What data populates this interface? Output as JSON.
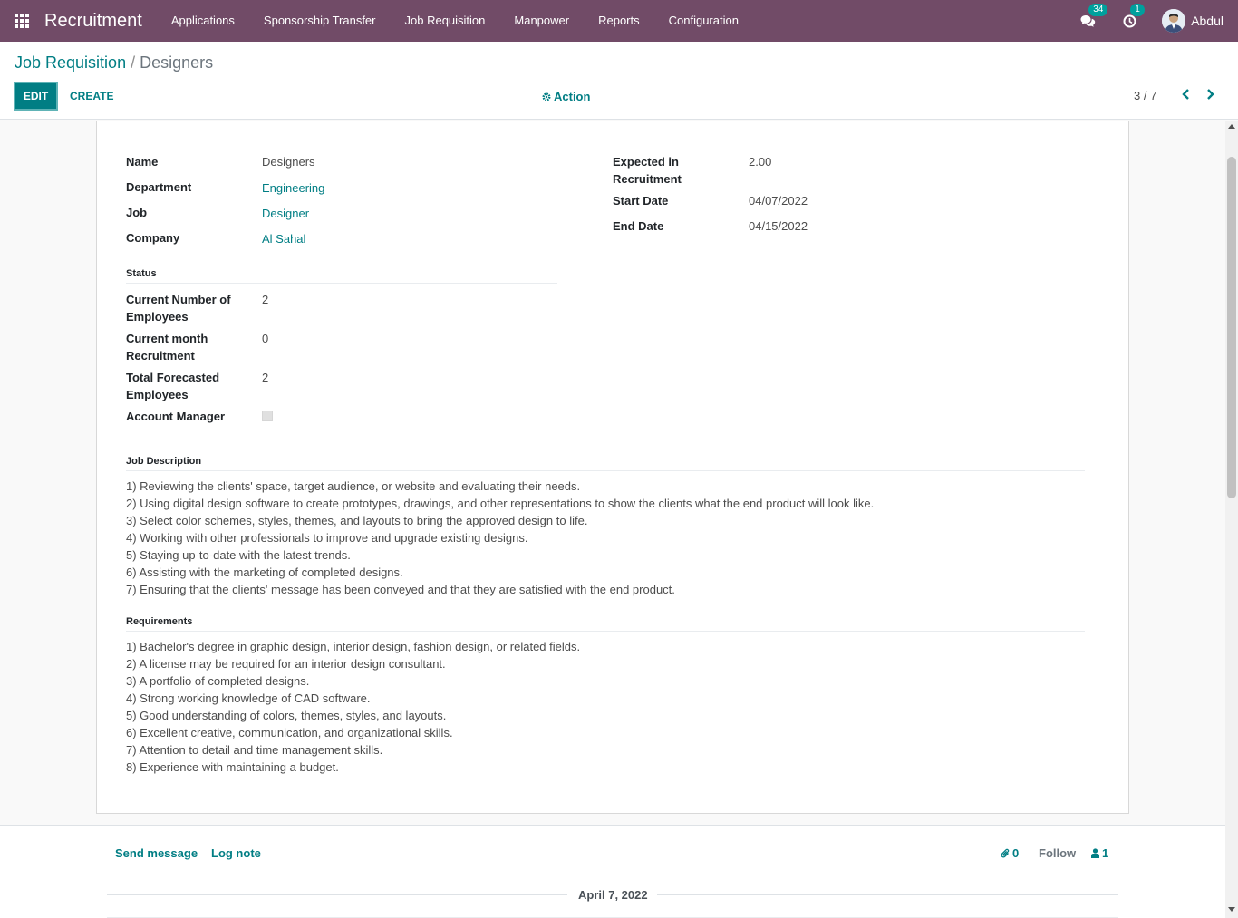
{
  "navbar": {
    "app_name": "Recruitment",
    "menu": [
      "Applications",
      "Sponsorship Transfer",
      "Job Requisition",
      "Manpower",
      "Reports",
      "Configuration"
    ],
    "messages_count": "34",
    "activities_count": "1",
    "user_name": "Abdul",
    "colors": {
      "bar": "#714b67",
      "badge": "#00a09d"
    }
  },
  "control_panel": {
    "breadcrumb_parent": "Job Requisition",
    "breadcrumb_separator": "/",
    "breadcrumb_current": "Designers",
    "edit_label": "EDIT",
    "create_label": "CREATE",
    "action_label": "Action",
    "pager": "3 / 7"
  },
  "form": {
    "name_label": "Name",
    "name_value": "Designers",
    "department_label": "Department",
    "department_value": "Engineering",
    "job_label": "Job",
    "job_value": "Designer",
    "company_label": "Company",
    "company_value": "Al Sahal",
    "expected_label_1": "Expected in",
    "expected_label_2": "Recruitment",
    "expected_value": "2.00",
    "start_label": "Start Date",
    "start_value": "04/07/2022",
    "end_label": "End Date",
    "end_value": "04/15/2022",
    "status_title": "Status",
    "current_employees_label_1": "Current Number of",
    "current_employees_label_2": "Employees",
    "current_employees_value": "2",
    "current_month_label_1": "Current month",
    "current_month_label_2": "Recruitment",
    "current_month_value": "0",
    "forecasted_label_1": "Total Forecasted",
    "forecasted_label_2": "Employees",
    "forecasted_value": "2",
    "account_manager_label": "Account Manager",
    "account_manager_checked": false,
    "job_description_title": "Job Description",
    "job_description": [
      "1) Reviewing the clients' space, target audience, or website and evaluating their needs.",
      "2) Using digital design software to create prototypes, drawings, and other representations to show the clients what the end product will look like.",
      "3) Select color schemes, styles, themes, and layouts to bring the approved design to life.",
      "4) Working with other professionals to improve and upgrade existing designs.",
      "5) Staying up-to-date with the latest trends.",
      "6) Assisting with the marketing of completed designs.",
      "7) Ensuring that the clients' message has been conveyed and that they are satisfied with the end product."
    ],
    "requirements_title": "Requirements",
    "requirements": [
      "1) Bachelor's degree in graphic design, interior design, fashion design, or related fields.",
      "2) A license may be required for an interior design consultant.",
      "3) A portfolio of completed designs.",
      "4) Strong working knowledge of CAD software.",
      "5) Good understanding of colors, themes, styles, and layouts.",
      "6) Excellent creative, communication, and organizational skills.",
      "7) Attention to detail and time management skills.",
      "8) Experience with maintaining a budget."
    ]
  },
  "chatter": {
    "send_message": "Send message",
    "log_note": "Log note",
    "attachments_count": "0",
    "follow_label": "Follow",
    "followers_count": "1",
    "date_separator": "April 7, 2022"
  },
  "colors": {
    "accent": "#017e84",
    "text": "#4c4c4c"
  }
}
